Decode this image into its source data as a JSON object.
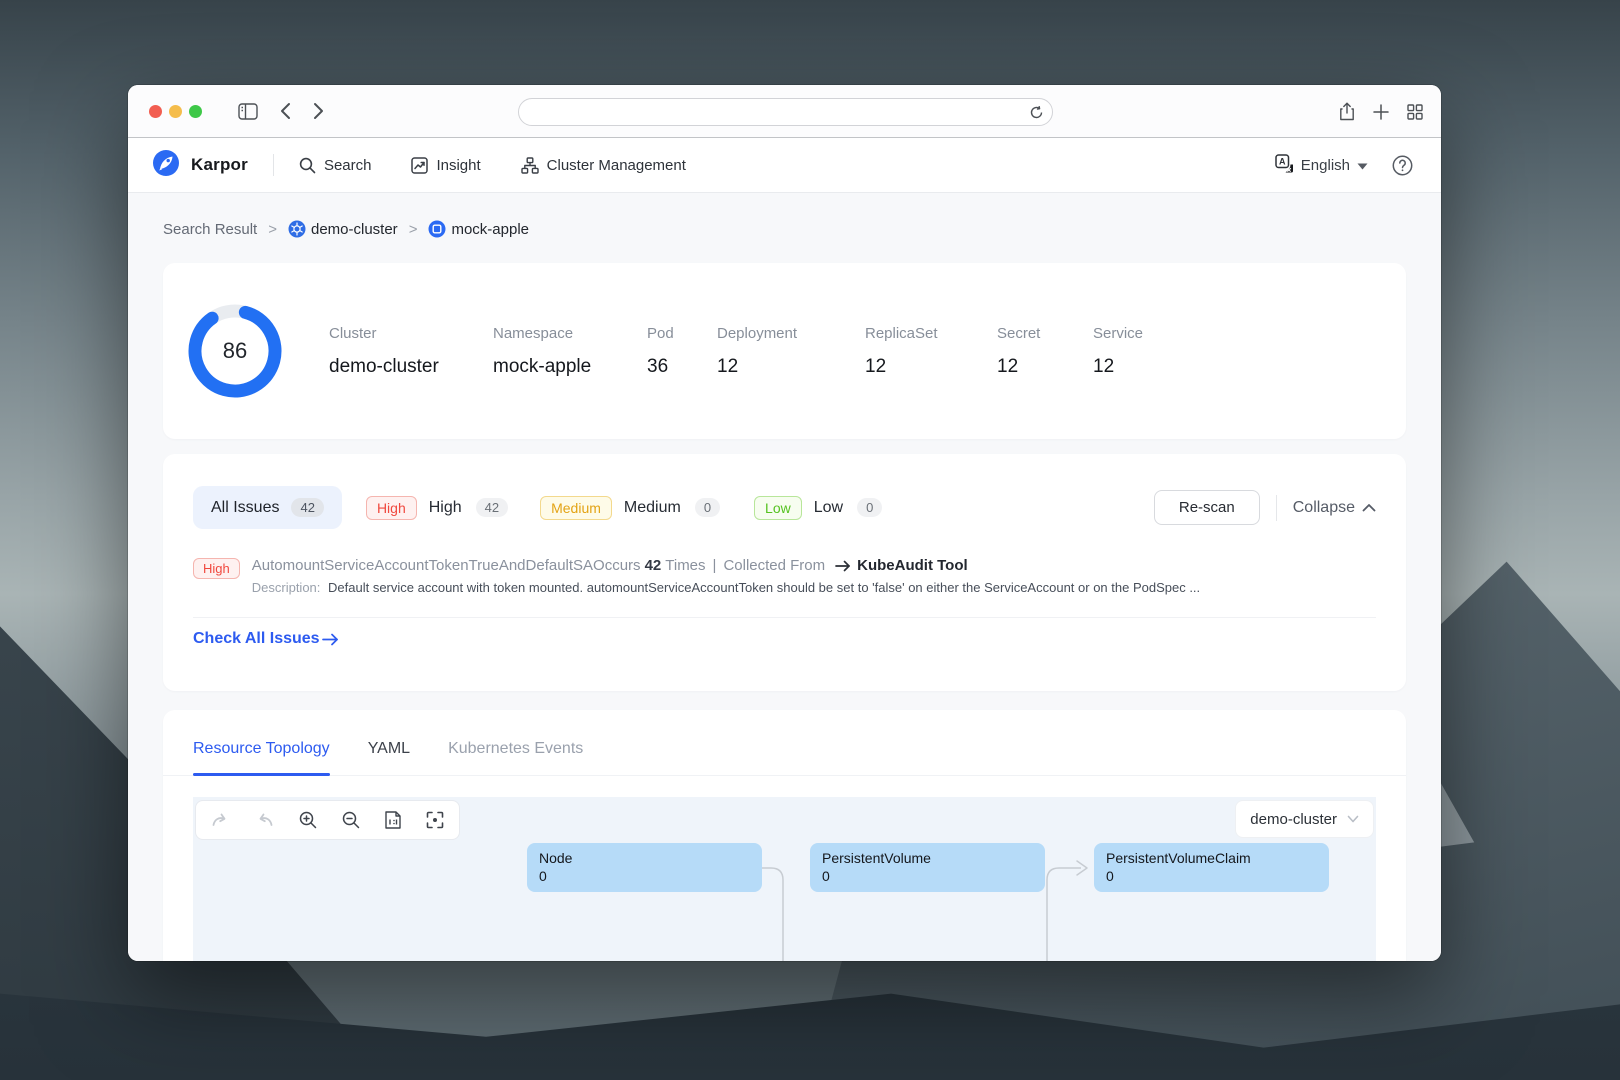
{
  "theme": {
    "accent_blue": "#2d5bf0",
    "ring_blue": "#2270f3",
    "ring_track": "#e9ecf0",
    "high_red": "#f0483e",
    "high_bg": "#fef1f0",
    "high_border": "#f5b5af",
    "medium_gold": "#e3a315",
    "medium_bg": "#fefbe8",
    "medium_border": "#f3d98d",
    "low_green": "#55c220",
    "low_bg": "#f7fdf0",
    "low_border": "#b8e69a",
    "node_fill": "#b6dbf8",
    "topology_bg": "#eff4fa",
    "selected_filter_bg": "#ecf2fd"
  },
  "browser": {
    "url": ""
  },
  "header": {
    "brand": "Karpor",
    "nav": [
      {
        "label": "Search"
      },
      {
        "label": "Insight"
      },
      {
        "label": "Cluster Management"
      }
    ],
    "language": "English"
  },
  "breadcrumb": {
    "separator": ">",
    "root": "Search Result",
    "cluster": "demo-cluster",
    "resource": "mock-apple"
  },
  "summary": {
    "score": "86",
    "stats": [
      {
        "label": "Cluster",
        "value": "demo-cluster"
      },
      {
        "label": "Namespace",
        "value": "mock-apple"
      },
      {
        "label": "Pod",
        "value": "36"
      },
      {
        "label": "Deployment",
        "value": "12"
      },
      {
        "label": "ReplicaSet",
        "value": "12"
      },
      {
        "label": "Secret",
        "value": "12"
      },
      {
        "label": "Service",
        "value": "12"
      }
    ]
  },
  "issues": {
    "all_label": "All Issues",
    "all_count": "42",
    "filters": [
      {
        "tag": "High",
        "label": "High",
        "count": "42"
      },
      {
        "tag": "Medium",
        "label": "Medium",
        "count": "0"
      },
      {
        "tag": "Low",
        "label": "Low",
        "count": "0"
      }
    ],
    "rescan_label": "Re-scan",
    "collapse_label": "Collapse",
    "row": {
      "severity": "High",
      "title_prefix": "AutomountServiceAccountTokenTrueAndDefaultSAOccurs",
      "occurs_count": "42",
      "occurs_suffix": "Times",
      "pipe": "|",
      "collected_from_label": "Collected From",
      "tool_name": "KubeAudit Tool",
      "description_label": "Description:",
      "description": "Default service account with token mounted. automountServiceAccountToken should be set to 'false' on either the ServiceAccount or on the PodSpec ..."
    },
    "check_all_label": "Check All Issues"
  },
  "detail": {
    "tabs": [
      {
        "label": "Resource Topology"
      },
      {
        "label": "YAML"
      },
      {
        "label": "Kubernetes Events"
      }
    ],
    "cluster_select": "demo-cluster",
    "nodes": [
      {
        "label": "Node",
        "count": "0"
      },
      {
        "label": "PersistentVolume",
        "count": "0"
      },
      {
        "label": "PersistentVolumeClaim",
        "count": "0"
      }
    ]
  }
}
